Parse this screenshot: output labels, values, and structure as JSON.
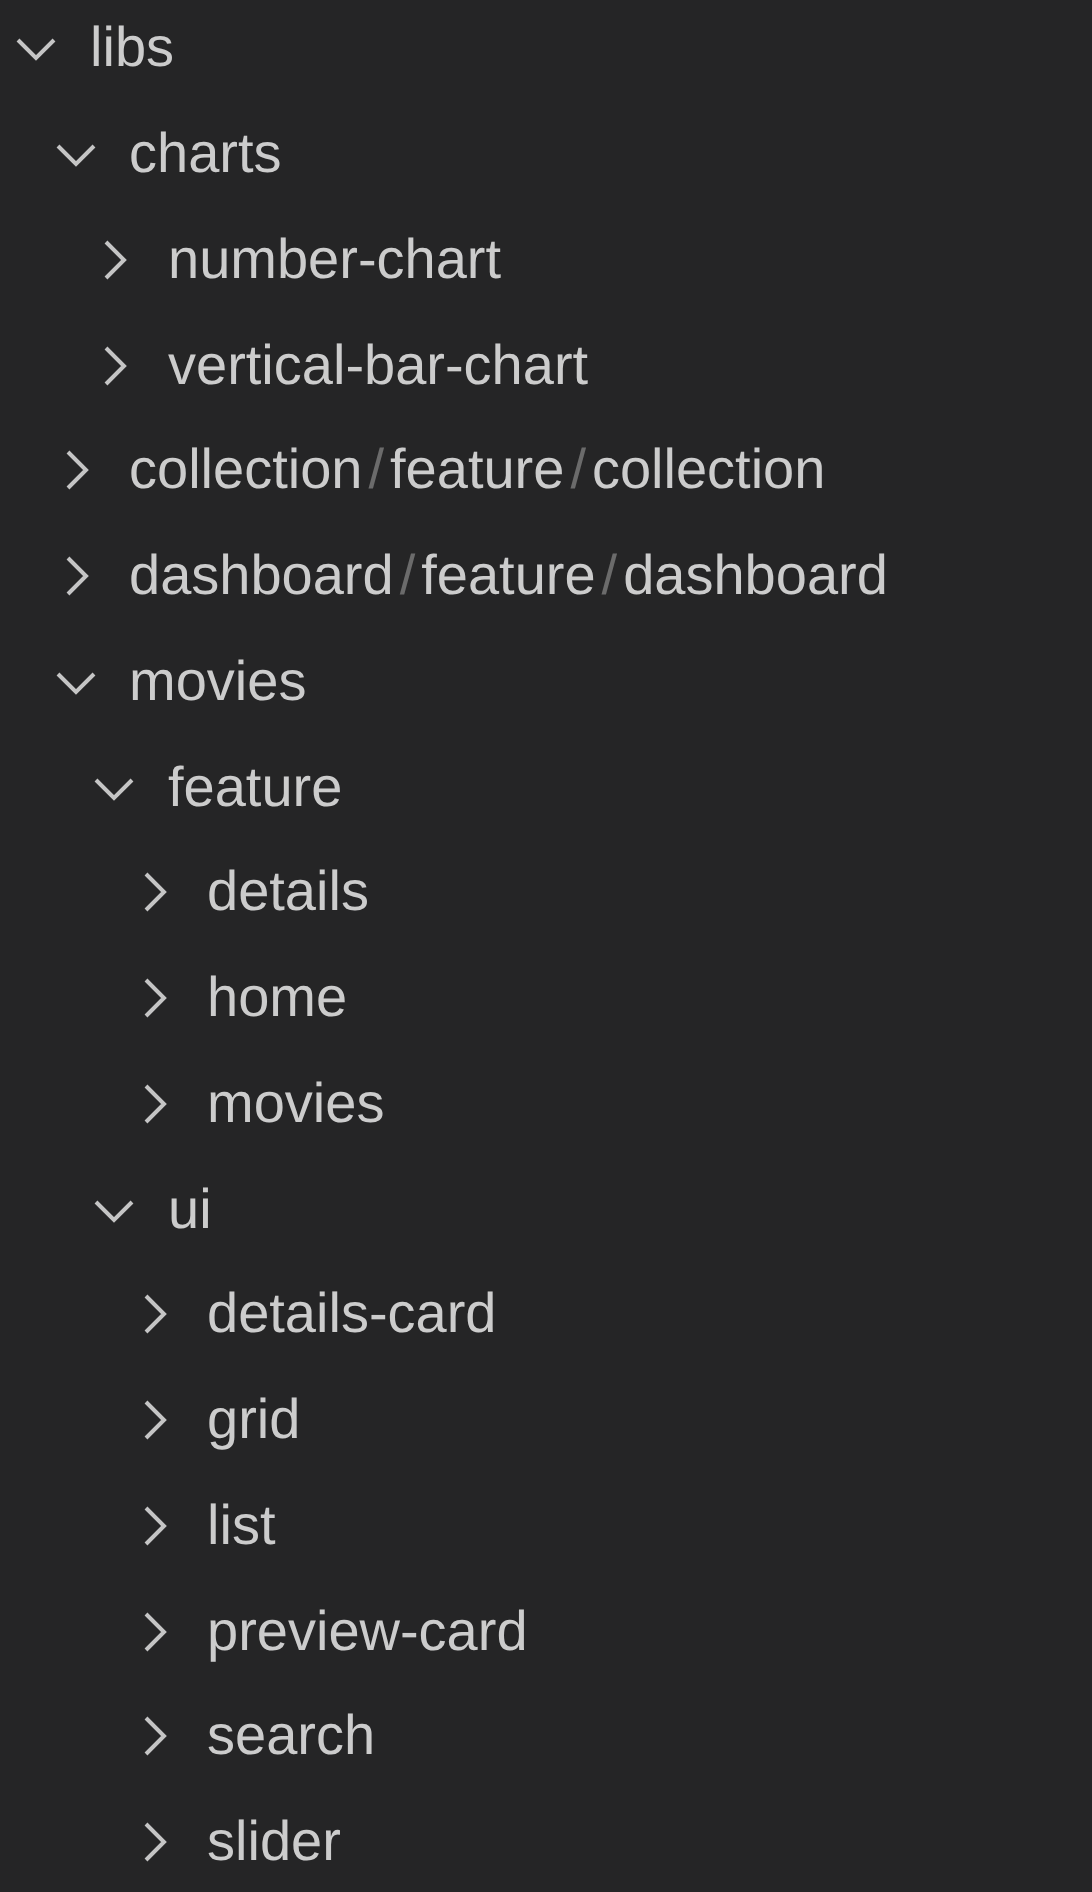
{
  "tree": [
    {
      "label": "libs",
      "expanded": true,
      "children": [
        {
          "label": "charts",
          "expanded": true,
          "children": [
            {
              "label": "number-chart",
              "expanded": false
            },
            {
              "label": "vertical-bar-chart",
              "expanded": false
            }
          ]
        },
        {
          "parts": [
            {
              "kind": "name",
              "text": "collection"
            },
            {
              "kind": "separator",
              "text": "/"
            },
            {
              "kind": "name",
              "text": "feature"
            },
            {
              "kind": "separator",
              "text": "/"
            },
            {
              "kind": "name",
              "text": "collection"
            }
          ],
          "expanded": false
        },
        {
          "parts": [
            {
              "kind": "name",
              "text": "dashboard"
            },
            {
              "kind": "separator",
              "text": "/"
            },
            {
              "kind": "name",
              "text": "feature"
            },
            {
              "kind": "separator",
              "text": "/"
            },
            {
              "kind": "name",
              "text": "dashboard"
            }
          ],
          "expanded": false
        },
        {
          "label": "movies",
          "expanded": true,
          "children": [
            {
              "label": "feature",
              "expanded": true,
              "children": [
                {
                  "label": "details",
                  "expanded": false
                },
                {
                  "label": "home",
                  "expanded": false
                },
                {
                  "label": "movies",
                  "expanded": false
                }
              ]
            },
            {
              "label": "ui",
              "expanded": true,
              "children": [
                {
                  "label": "details-card",
                  "expanded": false
                },
                {
                  "label": "grid",
                  "expanded": false
                },
                {
                  "label": "list",
                  "expanded": false
                },
                {
                  "label": "preview-card",
                  "expanded": false
                },
                {
                  "label": "search",
                  "expanded": false
                },
                {
                  "label": "slider",
                  "expanded": false
                }
              ]
            }
          ]
        }
      ]
    }
  ]
}
